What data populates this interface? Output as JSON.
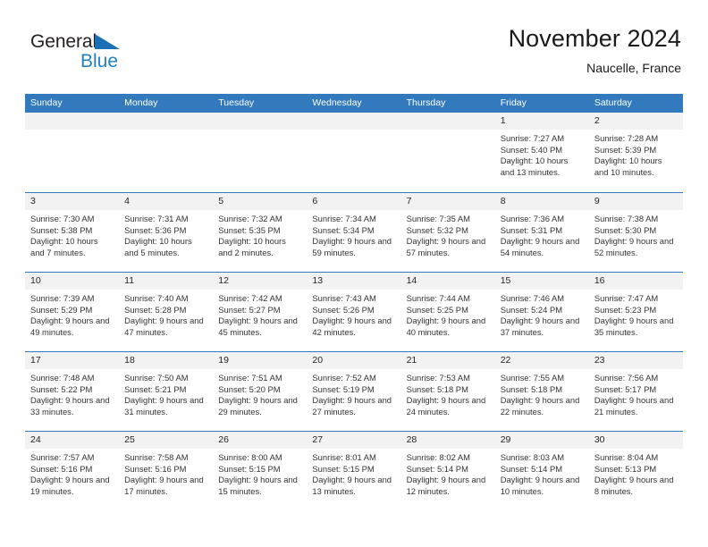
{
  "brand": {
    "name_part1": "General",
    "name_part2": "Blue",
    "triangle_color": "#1a6fb5",
    "blue_text_color": "#2080c8"
  },
  "header": {
    "title": "November 2024",
    "subtitle": "Naucelle, France"
  },
  "colors": {
    "header_blue": "#3279bd",
    "day_band_gray": "#f2f2f2",
    "text": "#231f20"
  },
  "weekdays": [
    "Sunday",
    "Monday",
    "Tuesday",
    "Wednesday",
    "Thursday",
    "Friday",
    "Saturday"
  ],
  "weeks": [
    [
      {
        "day": "",
        "sunrise": "",
        "sunset": "",
        "daylight": "",
        "empty": true
      },
      {
        "day": "",
        "sunrise": "",
        "sunset": "",
        "daylight": "",
        "empty": true
      },
      {
        "day": "",
        "sunrise": "",
        "sunset": "",
        "daylight": "",
        "empty": true
      },
      {
        "day": "",
        "sunrise": "",
        "sunset": "",
        "daylight": "",
        "empty": true
      },
      {
        "day": "",
        "sunrise": "",
        "sunset": "",
        "daylight": "",
        "empty": true
      },
      {
        "day": "1",
        "sunrise": "Sunrise: 7:27 AM",
        "sunset": "Sunset: 5:40 PM",
        "daylight": "Daylight: 10 hours and 13 minutes.",
        "empty": false
      },
      {
        "day": "2",
        "sunrise": "Sunrise: 7:28 AM",
        "sunset": "Sunset: 5:39 PM",
        "daylight": "Daylight: 10 hours and 10 minutes.",
        "empty": false
      }
    ],
    [
      {
        "day": "3",
        "sunrise": "Sunrise: 7:30 AM",
        "sunset": "Sunset: 5:38 PM",
        "daylight": "Daylight: 10 hours and 7 minutes.",
        "empty": false
      },
      {
        "day": "4",
        "sunrise": "Sunrise: 7:31 AM",
        "sunset": "Sunset: 5:36 PM",
        "daylight": "Daylight: 10 hours and 5 minutes.",
        "empty": false
      },
      {
        "day": "5",
        "sunrise": "Sunrise: 7:32 AM",
        "sunset": "Sunset: 5:35 PM",
        "daylight": "Daylight: 10 hours and 2 minutes.",
        "empty": false
      },
      {
        "day": "6",
        "sunrise": "Sunrise: 7:34 AM",
        "sunset": "Sunset: 5:34 PM",
        "daylight": "Daylight: 9 hours and 59 minutes.",
        "empty": false
      },
      {
        "day": "7",
        "sunrise": "Sunrise: 7:35 AM",
        "sunset": "Sunset: 5:32 PM",
        "daylight": "Daylight: 9 hours and 57 minutes.",
        "empty": false
      },
      {
        "day": "8",
        "sunrise": "Sunrise: 7:36 AM",
        "sunset": "Sunset: 5:31 PM",
        "daylight": "Daylight: 9 hours and 54 minutes.",
        "empty": false
      },
      {
        "day": "9",
        "sunrise": "Sunrise: 7:38 AM",
        "sunset": "Sunset: 5:30 PM",
        "daylight": "Daylight: 9 hours and 52 minutes.",
        "empty": false
      }
    ],
    [
      {
        "day": "10",
        "sunrise": "Sunrise: 7:39 AM",
        "sunset": "Sunset: 5:29 PM",
        "daylight": "Daylight: 9 hours and 49 minutes.",
        "empty": false
      },
      {
        "day": "11",
        "sunrise": "Sunrise: 7:40 AM",
        "sunset": "Sunset: 5:28 PM",
        "daylight": "Daylight: 9 hours and 47 minutes.",
        "empty": false
      },
      {
        "day": "12",
        "sunrise": "Sunrise: 7:42 AM",
        "sunset": "Sunset: 5:27 PM",
        "daylight": "Daylight: 9 hours and 45 minutes.",
        "empty": false
      },
      {
        "day": "13",
        "sunrise": "Sunrise: 7:43 AM",
        "sunset": "Sunset: 5:26 PM",
        "daylight": "Daylight: 9 hours and 42 minutes.",
        "empty": false
      },
      {
        "day": "14",
        "sunrise": "Sunrise: 7:44 AM",
        "sunset": "Sunset: 5:25 PM",
        "daylight": "Daylight: 9 hours and 40 minutes.",
        "empty": false
      },
      {
        "day": "15",
        "sunrise": "Sunrise: 7:46 AM",
        "sunset": "Sunset: 5:24 PM",
        "daylight": "Daylight: 9 hours and 37 minutes.",
        "empty": false
      },
      {
        "day": "16",
        "sunrise": "Sunrise: 7:47 AM",
        "sunset": "Sunset: 5:23 PM",
        "daylight": "Daylight: 9 hours and 35 minutes.",
        "empty": false
      }
    ],
    [
      {
        "day": "17",
        "sunrise": "Sunrise: 7:48 AM",
        "sunset": "Sunset: 5:22 PM",
        "daylight": "Daylight: 9 hours and 33 minutes.",
        "empty": false
      },
      {
        "day": "18",
        "sunrise": "Sunrise: 7:50 AM",
        "sunset": "Sunset: 5:21 PM",
        "daylight": "Daylight: 9 hours and 31 minutes.",
        "empty": false
      },
      {
        "day": "19",
        "sunrise": "Sunrise: 7:51 AM",
        "sunset": "Sunset: 5:20 PM",
        "daylight": "Daylight: 9 hours and 29 minutes.",
        "empty": false
      },
      {
        "day": "20",
        "sunrise": "Sunrise: 7:52 AM",
        "sunset": "Sunset: 5:19 PM",
        "daylight": "Daylight: 9 hours and 27 minutes.",
        "empty": false
      },
      {
        "day": "21",
        "sunrise": "Sunrise: 7:53 AM",
        "sunset": "Sunset: 5:18 PM",
        "daylight": "Daylight: 9 hours and 24 minutes.",
        "empty": false
      },
      {
        "day": "22",
        "sunrise": "Sunrise: 7:55 AM",
        "sunset": "Sunset: 5:18 PM",
        "daylight": "Daylight: 9 hours and 22 minutes.",
        "empty": false
      },
      {
        "day": "23",
        "sunrise": "Sunrise: 7:56 AM",
        "sunset": "Sunset: 5:17 PM",
        "daylight": "Daylight: 9 hours and 21 minutes.",
        "empty": false
      }
    ],
    [
      {
        "day": "24",
        "sunrise": "Sunrise: 7:57 AM",
        "sunset": "Sunset: 5:16 PM",
        "daylight": "Daylight: 9 hours and 19 minutes.",
        "empty": false
      },
      {
        "day": "25",
        "sunrise": "Sunrise: 7:58 AM",
        "sunset": "Sunset: 5:16 PM",
        "daylight": "Daylight: 9 hours and 17 minutes.",
        "empty": false
      },
      {
        "day": "26",
        "sunrise": "Sunrise: 8:00 AM",
        "sunset": "Sunset: 5:15 PM",
        "daylight": "Daylight: 9 hours and 15 minutes.",
        "empty": false
      },
      {
        "day": "27",
        "sunrise": "Sunrise: 8:01 AM",
        "sunset": "Sunset: 5:15 PM",
        "daylight": "Daylight: 9 hours and 13 minutes.",
        "empty": false
      },
      {
        "day": "28",
        "sunrise": "Sunrise: 8:02 AM",
        "sunset": "Sunset: 5:14 PM",
        "daylight": "Daylight: 9 hours and 12 minutes.",
        "empty": false
      },
      {
        "day": "29",
        "sunrise": "Sunrise: 8:03 AM",
        "sunset": "Sunset: 5:14 PM",
        "daylight": "Daylight: 9 hours and 10 minutes.",
        "empty": false
      },
      {
        "day": "30",
        "sunrise": "Sunrise: 8:04 AM",
        "sunset": "Sunset: 5:13 PM",
        "daylight": "Daylight: 9 hours and 8 minutes.",
        "empty": false
      }
    ]
  ]
}
